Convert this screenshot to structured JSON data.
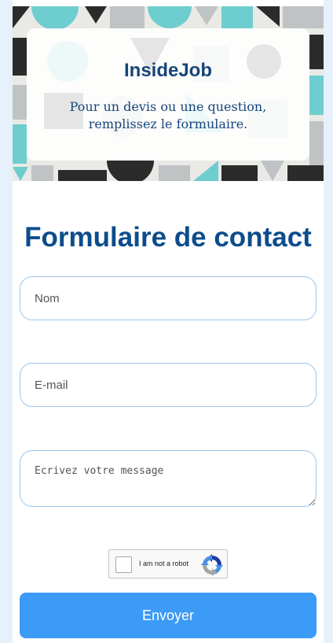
{
  "hero": {
    "title": "InsideJob",
    "subtitle": "Pour un devis ou une question, remplissez le formulaire."
  },
  "form": {
    "title": "Formulaire de contact",
    "name_placeholder": "Nom",
    "email_placeholder": "E-mail",
    "message_placeholder": "Ecrivez votre message",
    "captcha_label": "I am not a robot",
    "submit_label": "Envoyer"
  },
  "colors": {
    "page_bg": "#e6f1fc",
    "title": "#0d4c8c",
    "field_border": "#9cc7ee",
    "button": "#3b9bf7",
    "pattern_teal": "#6ecdcf",
    "pattern_dark": "#2b2b2b",
    "pattern_gray": "#bfc3c4"
  },
  "icons": {
    "captcha_logo": "recaptcha-icon"
  }
}
